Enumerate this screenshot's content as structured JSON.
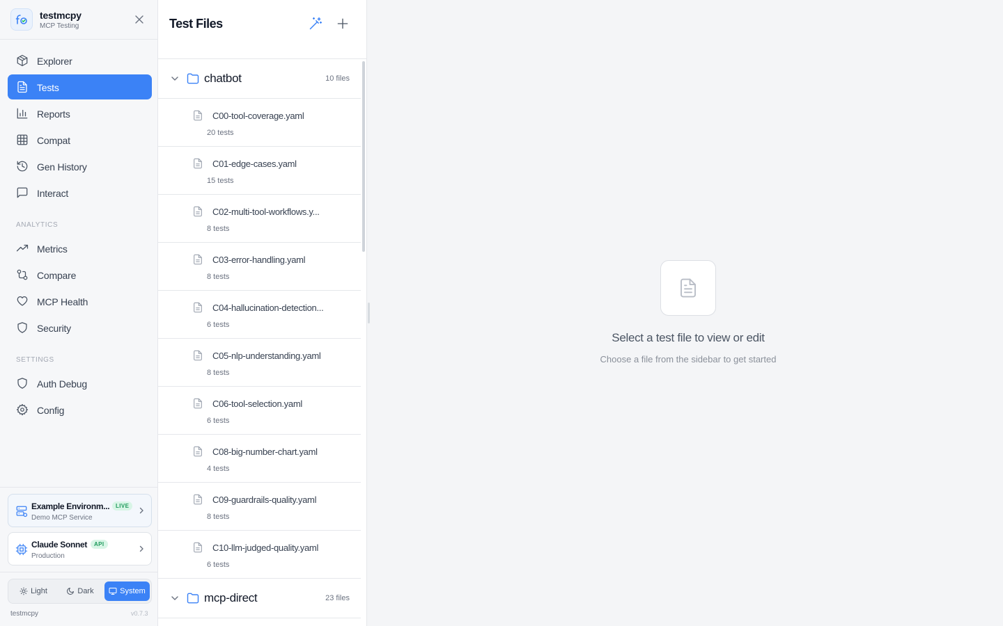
{
  "brand": {
    "name": "testmcpy",
    "subtitle": "MCP Testing"
  },
  "nav": {
    "main": [
      {
        "label": "Explorer",
        "icon": "package-icon",
        "active": false
      },
      {
        "label": "Tests",
        "icon": "file-text-icon",
        "active": true
      },
      {
        "label": "Reports",
        "icon": "bar-chart-icon",
        "active": false
      },
      {
        "label": "Compat",
        "icon": "grid-icon",
        "active": false
      },
      {
        "label": "Gen History",
        "icon": "history-icon",
        "active": false
      },
      {
        "label": "Interact",
        "icon": "message-square-icon",
        "active": false
      }
    ],
    "analytics_label": "ANALYTICS",
    "analytics": [
      {
        "label": "Metrics",
        "icon": "trending-up-icon"
      },
      {
        "label": "Compare",
        "icon": "git-compare-icon"
      },
      {
        "label": "MCP Health",
        "icon": "heart-icon"
      },
      {
        "label": "Security",
        "icon": "shield-icon"
      }
    ],
    "settings_label": "SETTINGS",
    "settings": [
      {
        "label": "Auth Debug",
        "icon": "shield-icon"
      },
      {
        "label": "Config",
        "icon": "gear-icon"
      }
    ]
  },
  "environment": {
    "title": "Example Environm...",
    "badge": "LIVE",
    "subtitle": "Demo MCP Service"
  },
  "model": {
    "title": "Claude Sonnet",
    "badge": "API",
    "subtitle": "Production"
  },
  "theme": {
    "light": "Light",
    "dark": "Dark",
    "system": "System",
    "selected": "System"
  },
  "footer": {
    "app": "testmcpy",
    "version": "v0.7.3"
  },
  "files_panel": {
    "title": "Test Files",
    "folders": [
      {
        "name": "chatbot",
        "count": "10 files",
        "expanded": true,
        "files": [
          {
            "name": "C00-tool-coverage.yaml",
            "tests": "20 tests"
          },
          {
            "name": "C01-edge-cases.yaml",
            "tests": "15 tests"
          },
          {
            "name": "C02-multi-tool-workflows.y...",
            "tests": "8 tests"
          },
          {
            "name": "C03-error-handling.yaml",
            "tests": "8 tests"
          },
          {
            "name": "C04-hallucination-detection...",
            "tests": "6 tests"
          },
          {
            "name": "C05-nlp-understanding.yaml",
            "tests": "8 tests"
          },
          {
            "name": "C06-tool-selection.yaml",
            "tests": "6 tests"
          },
          {
            "name": "C08-big-number-chart.yaml",
            "tests": "4 tests"
          },
          {
            "name": "C09-guardrails-quality.yaml",
            "tests": "8 tests"
          },
          {
            "name": "C10-llm-judged-quality.yaml",
            "tests": "6 tests"
          }
        ]
      },
      {
        "name": "mcp-direct",
        "count": "23 files",
        "expanded": true
      }
    ]
  },
  "empty_state": {
    "title": "Select a test file to view or edit",
    "subtitle": "Choose a file from the sidebar to get started"
  },
  "colors": {
    "accent": "#3b82f6",
    "live_badge": "#1f9a5c",
    "folder_icon": "#3b82f6"
  }
}
